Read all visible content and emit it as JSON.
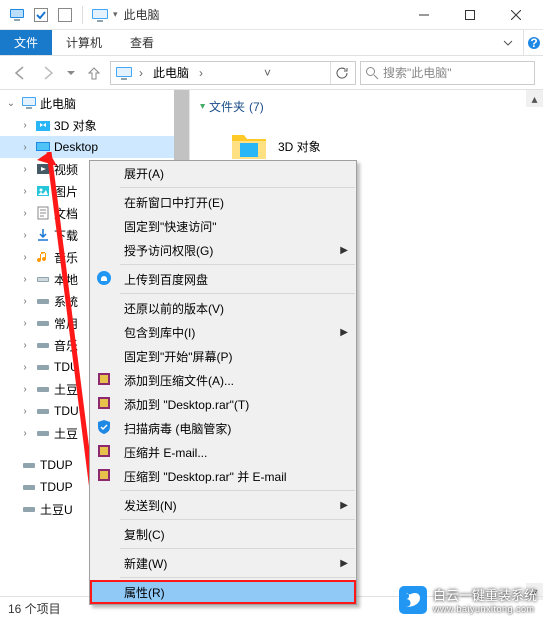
{
  "titlebar": {
    "title": "此电脑"
  },
  "ribbon": {
    "file": "文件",
    "computer": "计算机",
    "view": "查看"
  },
  "address": {
    "crumb": "此电脑"
  },
  "search": {
    "placeholder": "搜索\"此电脑\""
  },
  "tree": {
    "root": "此电脑",
    "items": [
      "3D 对象",
      "Desktop",
      "视频",
      "图片",
      "文档",
      "下载",
      "音乐",
      "本地",
      "系统",
      "常用",
      "音乐",
      "TDU",
      "土豆",
      "TDU",
      "土豆",
      "TDUP",
      "TDUP",
      "土豆U"
    ]
  },
  "content": {
    "group": "文件夹",
    "count": "(7)",
    "item0": "3D 对象"
  },
  "menu": {
    "expand": "展开(A)",
    "openNew": "在新窗口中打开(E)",
    "pin": "固定到\"快速访问\"",
    "grant": "授予访问权限(G)",
    "baidu": "上传到百度网盘",
    "restore": "还原以前的版本(V)",
    "include": "包含到库中(I)",
    "pinStart": "固定到\"开始\"屏幕(P)",
    "rarAdd": "添加到压缩文件(A)...",
    "rarAddTo": "添加到 \"Desktop.rar\"(T)",
    "scan": "扫描病毒 (电脑管家)",
    "rarEmail": "压缩并 E-mail...",
    "rarEmailTo": "压缩到 \"Desktop.rar\" 并 E-mail",
    "sendTo": "发送到(N)",
    "copy": "复制(C)",
    "new": "新建(W)",
    "props": "属性(R)"
  },
  "status": {
    "count": "16 个项目"
  },
  "watermark": {
    "title": "白云一键重装系统",
    "url": "www.baiyunxitong.com"
  }
}
